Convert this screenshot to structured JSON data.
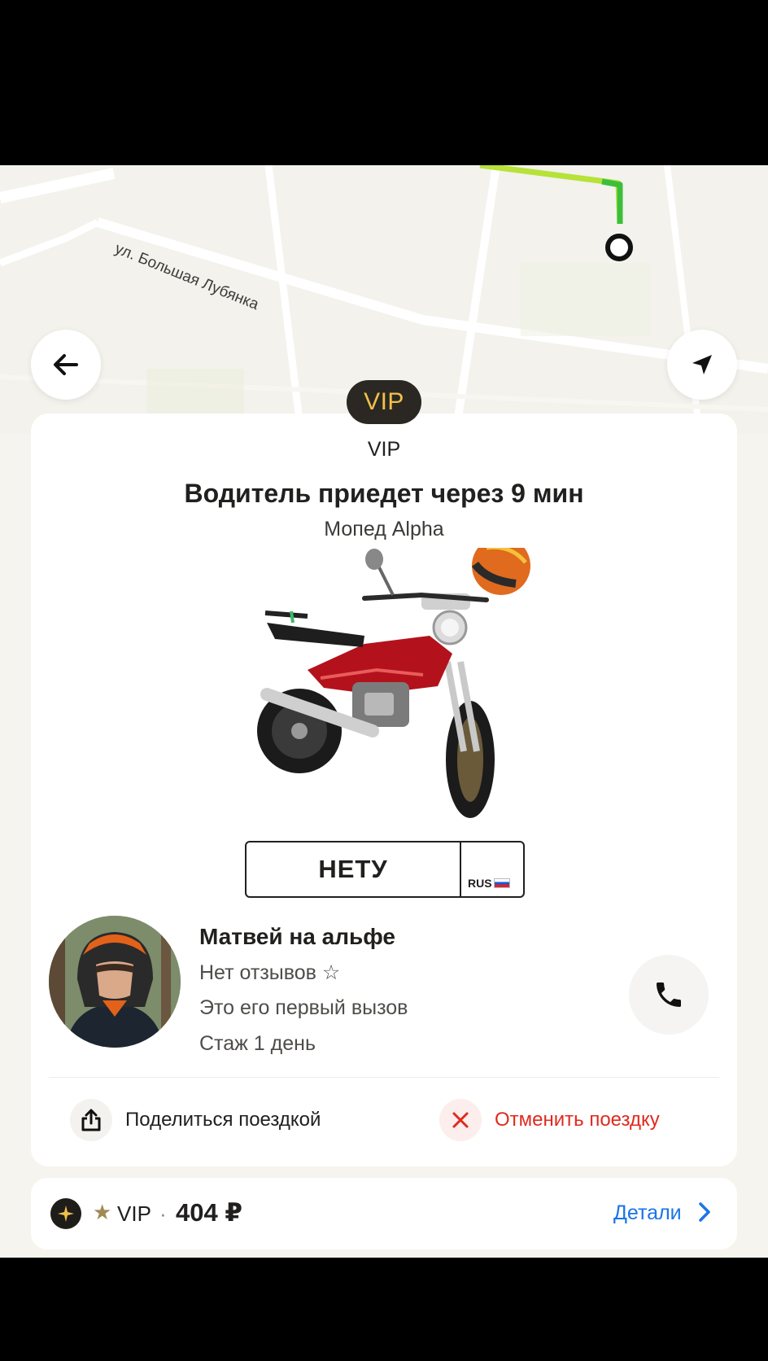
{
  "map": {
    "street_label": "ул. Большая Лубянка"
  },
  "tariff_badge": "VIP",
  "card": {
    "tariff": "VIP",
    "title": "Водитель приедет через 9 мин",
    "vehicle": "Мопед Alpha",
    "plate": {
      "number": "НЕТУ",
      "region": "RUS"
    }
  },
  "driver": {
    "name": "Матвей на альфе",
    "reviews": "Нет отзывов ☆",
    "first_call": "Это его первый вызов",
    "experience": "Стаж 1 день"
  },
  "actions": {
    "share": "Поделиться поездкой",
    "cancel": "Отменить поездку"
  },
  "footer": {
    "star": "★",
    "tariff": "VIP",
    "separator": "·",
    "price": "404 ₽",
    "details": "Детали"
  },
  "colors": {
    "accent_gold": "#f0c04a",
    "danger": "#e02a1f",
    "link": "#1a73e8",
    "route": "#b6e23a"
  },
  "icons": [
    "arrow-left-icon",
    "navigation-arrow-icon",
    "route-end-icon",
    "phone-icon",
    "share-icon",
    "close-icon",
    "tariff-star-icon",
    "chevron-right-icon"
  ]
}
